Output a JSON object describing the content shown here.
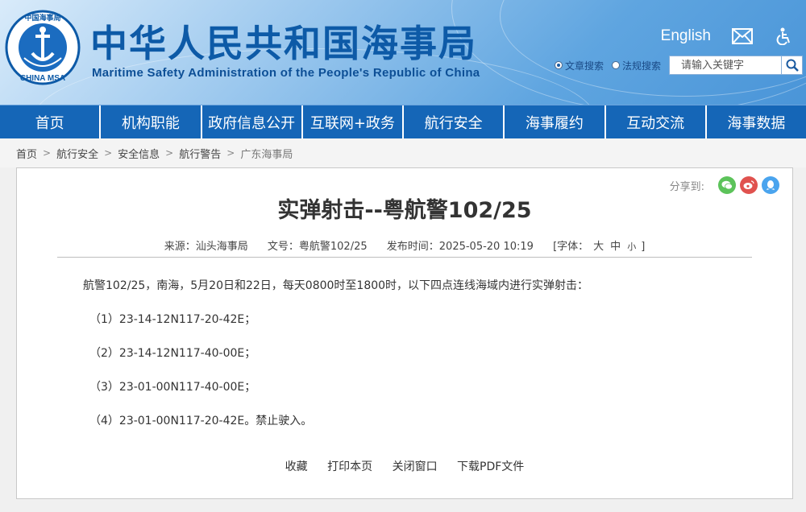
{
  "header": {
    "logo_text_top": "中国海事局",
    "logo_text_bottom": "CHINA MSA",
    "title_cn": "中华人民共和国海事局",
    "title_en": "Maritime Safety Administration of the People's Republic of China",
    "english_label": "English",
    "search": {
      "option_site": "文章搜索",
      "option_law": "法规搜索",
      "placeholder": "请输入关键字"
    }
  },
  "nav": {
    "items": [
      "首页",
      "机构职能",
      "政府信息公开",
      "互联网+政务",
      "航行安全",
      "海事履约",
      "互动交流",
      "海事数据"
    ]
  },
  "breadcrumb": {
    "items": [
      "首页",
      "航行安全",
      "安全信息",
      "航行警告"
    ],
    "current": "广东海事局",
    "sep": ">"
  },
  "article": {
    "share_label": "分享到:",
    "title": "实弹射击--粤航警102/25",
    "meta": {
      "source": "来源：汕头海事局",
      "doc_no": "文号：粤航警102/25",
      "publish": "发布时间：2025-05-20 10:19",
      "font_label": "[字体：",
      "font_large": "大",
      "font_medium": "中",
      "font_small": "小",
      "font_close": "]"
    },
    "intro": "航警102/25，南海，5月20日和22日，每天0800时至1800时，以下四点连线海域内进行实弹射击：",
    "points": [
      "（1）23-14-12N117-20-42E；",
      "（2）23-14-12N117-40-00E；",
      "（3）23-01-00N117-40-00E；",
      "（4）23-01-00N117-20-42E。禁止驶入。"
    ],
    "actions": {
      "favorite": "收藏",
      "print": "打印本页",
      "close": "关闭窗口",
      "download": "下载PDF文件"
    }
  },
  "colors": {
    "nav_bg": "#1566b7",
    "title_blue": "#0d5aa7",
    "wechat": "#5cc35a",
    "weibo": "#e0524f",
    "qq": "#4aa4ee"
  }
}
